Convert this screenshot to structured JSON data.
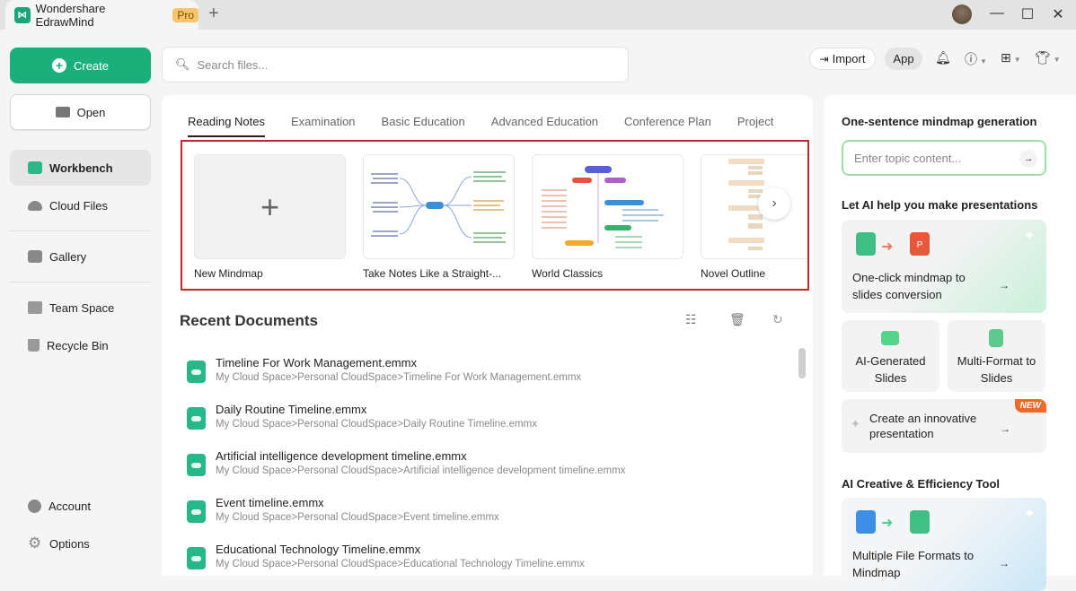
{
  "titlebar": {
    "app_title": "Wondershare EdrawMind",
    "pro_badge": "Pro",
    "new_tab": "+",
    "minimize": "—",
    "maximize": "☐",
    "close": "✕"
  },
  "sidebar": {
    "create_label": "Create",
    "open_label": "Open",
    "items": [
      {
        "label": "Workbench",
        "icon": "workbench-icon",
        "active": true
      },
      {
        "label": "Cloud Files",
        "icon": "cloud-icon"
      },
      {
        "label": "Gallery",
        "icon": "gallery-icon"
      },
      {
        "label": "Team Space",
        "icon": "team-space-icon"
      },
      {
        "label": "Recycle Bin",
        "icon": "recycle-bin-icon"
      }
    ],
    "bottom": [
      {
        "label": "Account",
        "icon": "account-icon"
      },
      {
        "label": "Options",
        "icon": "gear-icon"
      }
    ]
  },
  "search": {
    "placeholder": "Search files..."
  },
  "toolbar": {
    "import_label": "Import",
    "app_label": "App"
  },
  "main": {
    "tabs": [
      "Reading Notes",
      "Examination",
      "Basic Education",
      "Advanced Education",
      "Conference Plan",
      "Project"
    ],
    "templates": [
      "New Mindmap",
      "Take Notes Like a Straight-...",
      "World Classics",
      "Novel Outline"
    ],
    "recent_title": "Recent Documents",
    "documents": [
      {
        "name": "Timeline For Work Management.emmx",
        "path": "My Cloud Space>Personal CloudSpace>Timeline For Work Management.emmx"
      },
      {
        "name": "Daily Routine Timeline.emmx",
        "path": "My Cloud Space>Personal CloudSpace>Daily Routine Timeline.emmx"
      },
      {
        "name": "Artificial intelligence development timeline.emmx",
        "path": "My Cloud Space>Personal CloudSpace>Artificial intelligence development timeline.emmx"
      },
      {
        "name": "Event timeline.emmx",
        "path": "My Cloud Space>Personal CloudSpace>Event timeline.emmx"
      },
      {
        "name": "Educational Technology Timeline.emmx",
        "path": "My Cloud Space>Personal CloudSpace>Educational Technology Timeline.emmx"
      }
    ]
  },
  "right": {
    "gen_title": "One-sentence mindmap generation",
    "topic_placeholder": "Enter topic content...",
    "ppt_title": "Let AI help you make presentations",
    "card_mindmap_slides": "One-click mindmap to slides conversion",
    "card_ai_slides": "AI-Generated Slides",
    "card_multi_format": "Multi-Format to Slides",
    "card_innovative": "Create an innovative presentation",
    "new_badge": "NEW",
    "tool_title": "AI Creative & Efficiency Tool",
    "card_file_formats": "Multiple File Formats to Mindmap"
  },
  "colors": {
    "accent": "#1aaf7b",
    "highlight_border": "#c4262e",
    "new_badge": "#ef6a26"
  }
}
